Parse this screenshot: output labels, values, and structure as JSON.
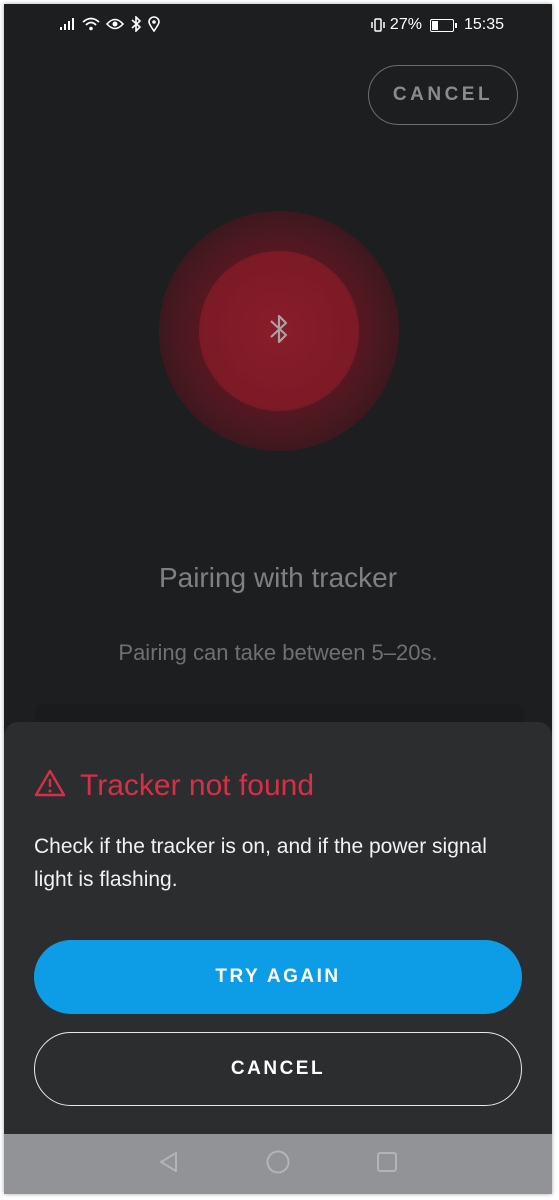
{
  "status_bar": {
    "battery_percent_text": "27%",
    "battery_level": 0.27,
    "time": "15:35",
    "icons": [
      "signal-icon",
      "wifi-icon",
      "eye-icon",
      "bluetooth-icon",
      "location-icon",
      "vibrate-icon",
      "battery-icon"
    ]
  },
  "header": {
    "cancel_label": "CANCEL"
  },
  "pairing": {
    "title": "Pairing with tracker",
    "subtitle": "Pairing can take between 5–20s.",
    "icon": "bluetooth-icon"
  },
  "dialog": {
    "title": "Tracker not found",
    "icon": "warning-icon",
    "message": "Check if the tracker is on, and if the power signal light is flashing.",
    "primary_label": "TRY AGAIN",
    "secondary_label": "CANCEL"
  },
  "nav_bar": {
    "icons": [
      "back-icon",
      "home-icon",
      "recents-icon"
    ]
  },
  "colors": {
    "background": "#1d1e20",
    "sheet": "#2c2d2f",
    "accent_red": "#d72f48",
    "primary_blue": "#0d9de6",
    "pulse_red": "#8a1c2a"
  }
}
